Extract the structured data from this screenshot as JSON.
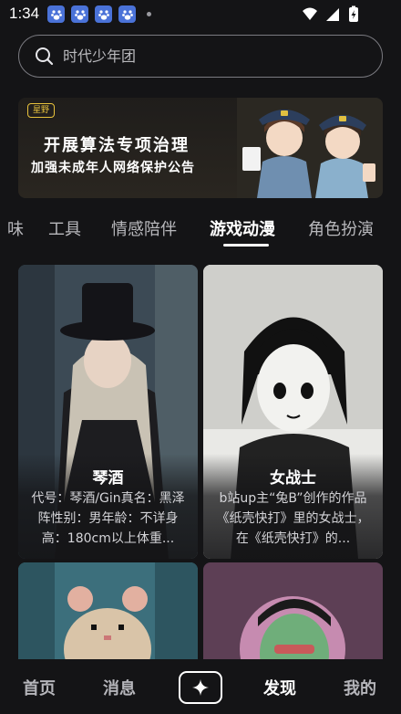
{
  "status_bar": {
    "time": "1:34"
  },
  "search": {
    "placeholder": "时代少年团"
  },
  "banner": {
    "logo": "星野",
    "title": "开展算法专项治理",
    "subtitle": "加强未成年人网络保护公告"
  },
  "tabs": [
    {
      "label": "味"
    },
    {
      "label": "工具"
    },
    {
      "label": "情感陪伴"
    },
    {
      "label": "游戏动漫",
      "active": true
    },
    {
      "label": "角色扮演"
    }
  ],
  "cards": [
    {
      "name": "琴酒",
      "description": "代号：琴酒/Gin真名：黑泽阵性别：男年龄：不详身高：180cm以上体重..."
    },
    {
      "name": "女战士",
      "description": "b站up主“兔B”创作的作品《纸壳快打》里的女战士，在《纸壳快打》的..."
    },
    {
      "name": "",
      "description": ""
    },
    {
      "name": "",
      "description": ""
    }
  ],
  "bottom_nav": {
    "home": "首页",
    "messages": "消息",
    "create_icon": "sparkle-icon",
    "discover": "发现",
    "mine": "我的",
    "active": "discover"
  },
  "colors": {
    "background": "#141416",
    "notification_badge": "#4a72d8",
    "banner_logo": "#e8c23c"
  }
}
